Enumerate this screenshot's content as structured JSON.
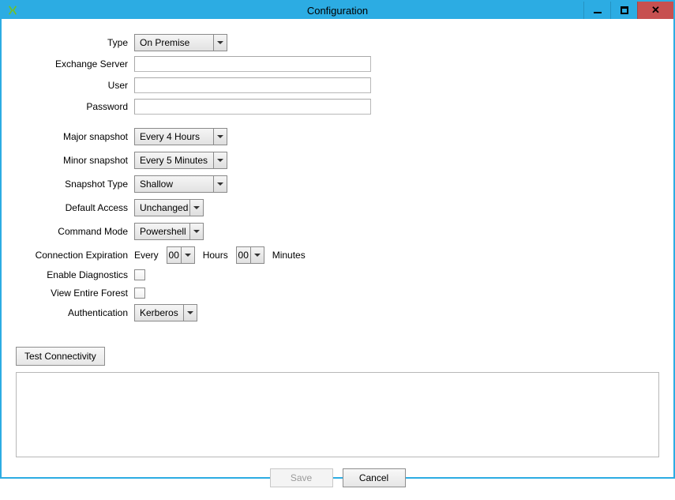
{
  "window": {
    "title": "Configuration"
  },
  "labels": {
    "type": "Type",
    "exchange_server": "Exchange Server",
    "user": "User",
    "password": "Password",
    "major_snapshot": "Major snapshot",
    "minor_snapshot": "Minor snapshot",
    "snapshot_type": "Snapshot Type",
    "default_access": "Default Access",
    "command_mode": "Command Mode",
    "connection_expiration": "Connection Expiration",
    "enable_diagnostics": "Enable Diagnostics",
    "view_entire_forest": "View Entire Forest",
    "authentication": "Authentication",
    "every": "Every",
    "hours": "Hours",
    "minutes": "Minutes"
  },
  "values": {
    "type": "On Premise",
    "exchange_server": "",
    "user": "",
    "password": "",
    "major_snapshot": "Every 4 Hours",
    "minor_snapshot": "Every 5 Minutes",
    "snapshot_type": "Shallow",
    "default_access": "Unchanged",
    "command_mode": "Powershell",
    "expiration_hours": "00",
    "expiration_minutes": "00",
    "enable_diagnostics": false,
    "view_entire_forest": false,
    "authentication": "Kerberos"
  },
  "buttons": {
    "test_connectivity": "Test Connectivity",
    "save": "Save",
    "cancel": "Cancel"
  }
}
